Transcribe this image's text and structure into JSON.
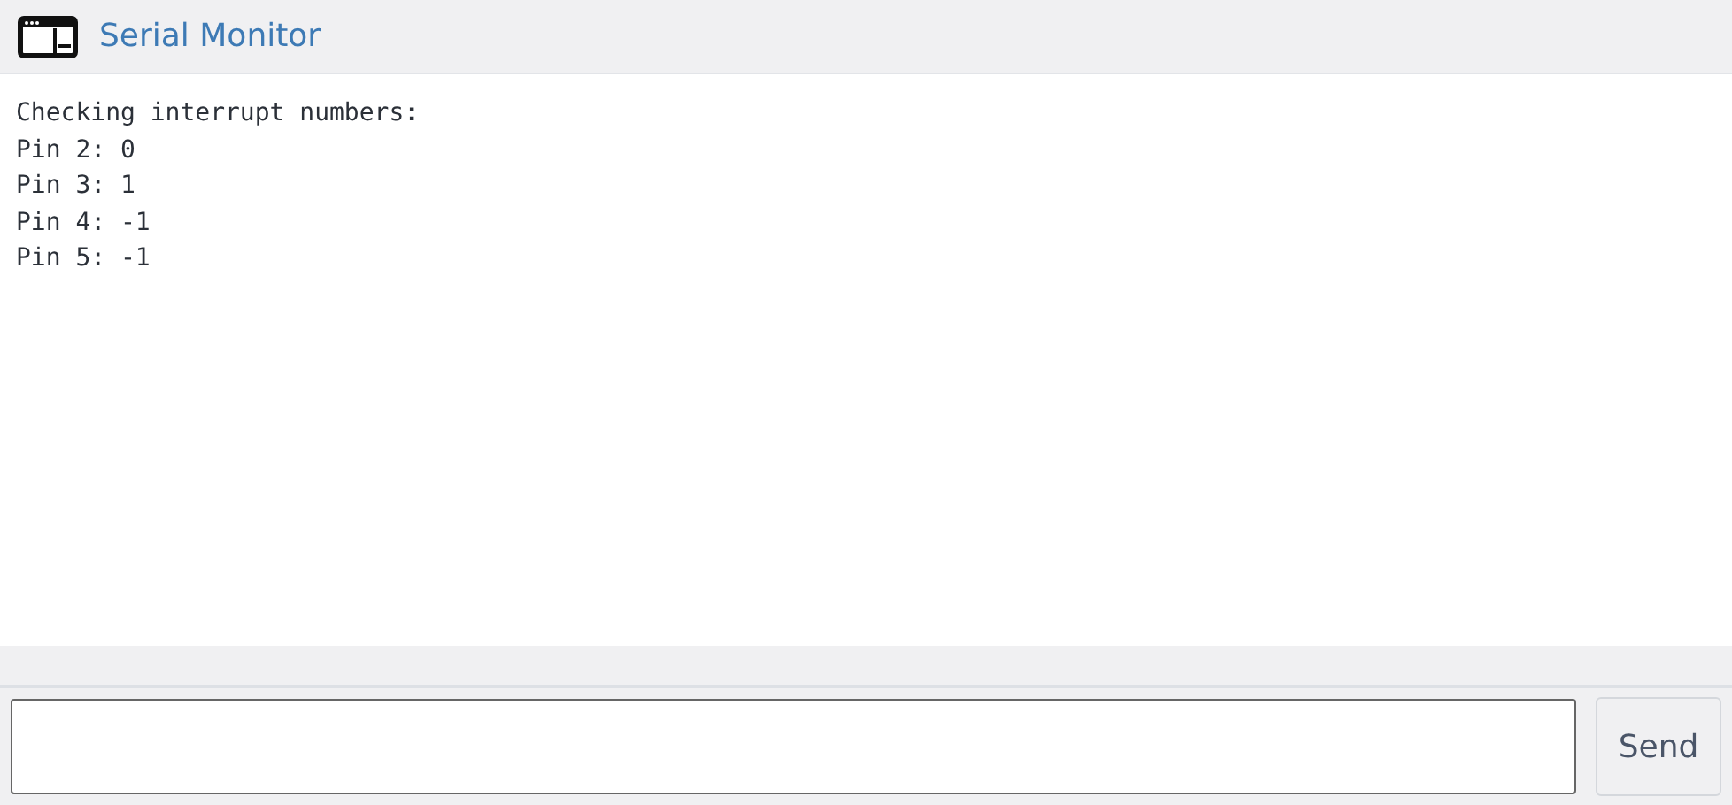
{
  "window": {
    "title": "Serial Monitor"
  },
  "output": [
    "Checking interrupt numbers:",
    "Pin 2: 0",
    "Pin 3: 1",
    "Pin 4: -1",
    "Pin 5: -1"
  ],
  "send_button": {
    "label": "Send"
  }
}
